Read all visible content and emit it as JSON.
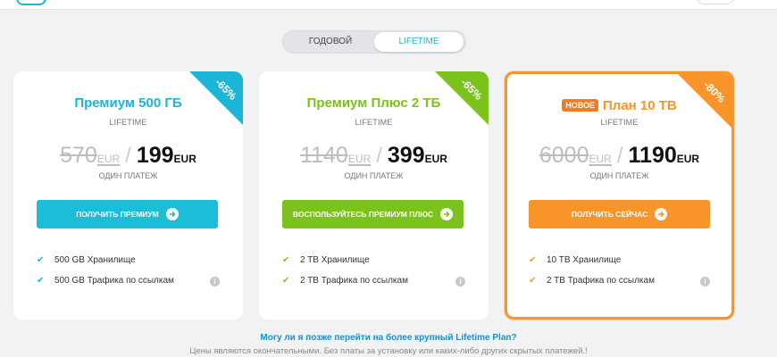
{
  "toggle": {
    "yearly": "ГОДОВОЙ",
    "lifetime": "LIFETIME"
  },
  "colors": {
    "cyan": "#1bb6d6",
    "green": "#7cc21c",
    "orange": "#f7942a"
  },
  "plans": [
    {
      "discount": "-65%",
      "badge": "",
      "title": "Премиум 500 ГБ",
      "subtitle": "LIFETIME",
      "old_price": "570",
      "new_price": "199",
      "currency": "EUR",
      "payment_note": "ОДИН ПЛАТЕЖ",
      "cta": "ПОЛУЧИТЬ ПРЕМИУМ",
      "features": [
        "500 GB Хранилище",
        "500 GB Трафика по ссылкам"
      ]
    },
    {
      "discount": "-65%",
      "badge": "",
      "title": "Премиум Плюс 2 ТБ",
      "subtitle": "LIFETIME",
      "old_price": "1140",
      "new_price": "399",
      "currency": "EUR",
      "payment_note": "ОДИН ПЛАТЕЖ",
      "cta": "ВОСПОЛЬЗУЙТЕСЬ ПРЕМИУМ ПЛЮС",
      "features": [
        "2 TB Хранилище",
        "2 TB Трафика по ссылкам"
      ]
    },
    {
      "discount": "-80%",
      "badge": "НОВОЕ",
      "title": "План 10 TB",
      "subtitle": "LIFETIME",
      "old_price": "6000",
      "new_price": "1190",
      "currency": "EUR",
      "payment_note": "ОДИН ПЛАТЕЖ",
      "cta": "ПОЛУЧИТЬ СЕЙЧАС",
      "features": [
        "10 TB Хранилище",
        "2 TB Трафика по ссылкам"
      ]
    }
  ],
  "footer": {
    "question": "Могу ли я позже перейти на более крупный Lifetime Plan?",
    "note": "Цены являются окончательными. Без платы за установку или каких-либо других скрытых платежей.!"
  },
  "icons": {
    "check": "check-icon",
    "info": "info-icon",
    "arrow": "arrow-right-circle-icon"
  }
}
